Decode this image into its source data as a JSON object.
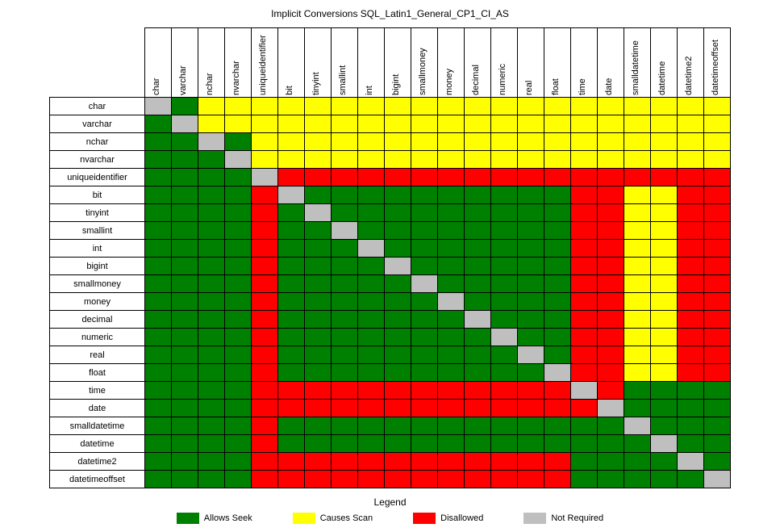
{
  "title": "Implicit Conversions SQL_Latin1_General_CP1_CI_AS",
  "types": [
    "char",
    "varchar",
    "nchar",
    "nvarchar",
    "uniqueidentifier",
    "bit",
    "tinyint",
    "smallint",
    "int",
    "bigint",
    "smallmoney",
    "money",
    "decimal",
    "numeric",
    "real",
    "float",
    "time",
    "date",
    "smalldatetime",
    "datetime",
    "datetime2",
    "datetimeoffset"
  ],
  "legend_title": "Legend",
  "legend": {
    "K": {
      "label": "Allows Seek",
      "color": "#008000"
    },
    "S": {
      "label": "Causes Scan",
      "color": "#ffff00"
    },
    "D": {
      "label": "Disallowed",
      "color": "#ff0000"
    },
    "N": {
      "label": "Not Required",
      "color": "#bfbfbf"
    }
  },
  "chart_data": {
    "type": "heatmap",
    "title": "Implicit Conversions SQL_Latin1_General_CP1_CI_AS",
    "xlabel": "",
    "ylabel": "",
    "rows": [
      "char",
      "varchar",
      "nchar",
      "nvarchar",
      "uniqueidentifier",
      "bit",
      "tinyint",
      "smallint",
      "int",
      "bigint",
      "smallmoney",
      "money",
      "decimal",
      "numeric",
      "real",
      "float",
      "time",
      "date",
      "smalldatetime",
      "datetime",
      "datetime2",
      "datetimeoffset"
    ],
    "cols": [
      "char",
      "varchar",
      "nchar",
      "nvarchar",
      "uniqueidentifier",
      "bit",
      "tinyint",
      "smallint",
      "int",
      "bigint",
      "smallmoney",
      "money",
      "decimal",
      "numeric",
      "real",
      "float",
      "time",
      "date",
      "smalldatetime",
      "datetime",
      "datetime2",
      "datetimeoffset"
    ],
    "value_key": {
      "K": "Allows Seek",
      "S": "Causes Scan",
      "D": "Disallowed",
      "N": "Not Required"
    },
    "grid": [
      [
        "N",
        "K",
        "S",
        "S",
        "S",
        "S",
        "S",
        "S",
        "S",
        "S",
        "S",
        "S",
        "S",
        "S",
        "S",
        "S",
        "S",
        "S",
        "S",
        "S",
        "S",
        "S"
      ],
      [
        "K",
        "N",
        "S",
        "S",
        "S",
        "S",
        "S",
        "S",
        "S",
        "S",
        "S",
        "S",
        "S",
        "S",
        "S",
        "S",
        "S",
        "S",
        "S",
        "S",
        "S",
        "S"
      ],
      [
        "K",
        "K",
        "N",
        "K",
        "S",
        "S",
        "S",
        "S",
        "S",
        "S",
        "S",
        "S",
        "S",
        "S",
        "S",
        "S",
        "S",
        "S",
        "S",
        "S",
        "S",
        "S"
      ],
      [
        "K",
        "K",
        "K",
        "N",
        "S",
        "S",
        "S",
        "S",
        "S",
        "S",
        "S",
        "S",
        "S",
        "S",
        "S",
        "S",
        "S",
        "S",
        "S",
        "S",
        "S",
        "S"
      ],
      [
        "K",
        "K",
        "K",
        "K",
        "N",
        "D",
        "D",
        "D",
        "D",
        "D",
        "D",
        "D",
        "D",
        "D",
        "D",
        "D",
        "D",
        "D",
        "D",
        "D",
        "D",
        "D"
      ],
      [
        "K",
        "K",
        "K",
        "K",
        "D",
        "N",
        "K",
        "K",
        "K",
        "K",
        "K",
        "K",
        "K",
        "K",
        "K",
        "K",
        "D",
        "D",
        "S",
        "S",
        "D",
        "D"
      ],
      [
        "K",
        "K",
        "K",
        "K",
        "D",
        "K",
        "N",
        "K",
        "K",
        "K",
        "K",
        "K",
        "K",
        "K",
        "K",
        "K",
        "D",
        "D",
        "S",
        "S",
        "D",
        "D"
      ],
      [
        "K",
        "K",
        "K",
        "K",
        "D",
        "K",
        "K",
        "N",
        "K",
        "K",
        "K",
        "K",
        "K",
        "K",
        "K",
        "K",
        "D",
        "D",
        "S",
        "S",
        "D",
        "D"
      ],
      [
        "K",
        "K",
        "K",
        "K",
        "D",
        "K",
        "K",
        "K",
        "N",
        "K",
        "K",
        "K",
        "K",
        "K",
        "K",
        "K",
        "D",
        "D",
        "S",
        "S",
        "D",
        "D"
      ],
      [
        "K",
        "K",
        "K",
        "K",
        "D",
        "K",
        "K",
        "K",
        "K",
        "N",
        "K",
        "K",
        "K",
        "K",
        "K",
        "K",
        "D",
        "D",
        "S",
        "S",
        "D",
        "D"
      ],
      [
        "K",
        "K",
        "K",
        "K",
        "D",
        "K",
        "K",
        "K",
        "K",
        "K",
        "N",
        "K",
        "K",
        "K",
        "K",
        "K",
        "D",
        "D",
        "S",
        "S",
        "D",
        "D"
      ],
      [
        "K",
        "K",
        "K",
        "K",
        "D",
        "K",
        "K",
        "K",
        "K",
        "K",
        "K",
        "N",
        "K",
        "K",
        "K",
        "K",
        "D",
        "D",
        "S",
        "S",
        "D",
        "D"
      ],
      [
        "K",
        "K",
        "K",
        "K",
        "D",
        "K",
        "K",
        "K",
        "K",
        "K",
        "K",
        "K",
        "N",
        "K",
        "K",
        "K",
        "D",
        "D",
        "S",
        "S",
        "D",
        "D"
      ],
      [
        "K",
        "K",
        "K",
        "K",
        "D",
        "K",
        "K",
        "K",
        "K",
        "K",
        "K",
        "K",
        "K",
        "N",
        "K",
        "K",
        "D",
        "D",
        "S",
        "S",
        "D",
        "D"
      ],
      [
        "K",
        "K",
        "K",
        "K",
        "D",
        "K",
        "K",
        "K",
        "K",
        "K",
        "K",
        "K",
        "K",
        "K",
        "N",
        "K",
        "D",
        "D",
        "S",
        "S",
        "D",
        "D"
      ],
      [
        "K",
        "K",
        "K",
        "K",
        "D",
        "K",
        "K",
        "K",
        "K",
        "K",
        "K",
        "K",
        "K",
        "K",
        "K",
        "N",
        "D",
        "D",
        "S",
        "S",
        "D",
        "D"
      ],
      [
        "K",
        "K",
        "K",
        "K",
        "D",
        "D",
        "D",
        "D",
        "D",
        "D",
        "D",
        "D",
        "D",
        "D",
        "D",
        "D",
        "N",
        "D",
        "K",
        "K",
        "K",
        "K"
      ],
      [
        "K",
        "K",
        "K",
        "K",
        "D",
        "D",
        "D",
        "D",
        "D",
        "D",
        "D",
        "D",
        "D",
        "D",
        "D",
        "D",
        "D",
        "N",
        "K",
        "K",
        "K",
        "K"
      ],
      [
        "K",
        "K",
        "K",
        "K",
        "D",
        "K",
        "K",
        "K",
        "K",
        "K",
        "K",
        "K",
        "K",
        "K",
        "K",
        "K",
        "K",
        "K",
        "N",
        "K",
        "K",
        "K"
      ],
      [
        "K",
        "K",
        "K",
        "K",
        "D",
        "K",
        "K",
        "K",
        "K",
        "K",
        "K",
        "K",
        "K",
        "K",
        "K",
        "K",
        "K",
        "K",
        "K",
        "N",
        "K",
        "K"
      ],
      [
        "K",
        "K",
        "K",
        "K",
        "D",
        "D",
        "D",
        "D",
        "D",
        "D",
        "D",
        "D",
        "D",
        "D",
        "D",
        "D",
        "K",
        "K",
        "K",
        "K",
        "N",
        "K"
      ],
      [
        "K",
        "K",
        "K",
        "K",
        "D",
        "D",
        "D",
        "D",
        "D",
        "D",
        "D",
        "D",
        "D",
        "D",
        "D",
        "D",
        "K",
        "K",
        "K",
        "K",
        "K",
        "N"
      ]
    ]
  }
}
